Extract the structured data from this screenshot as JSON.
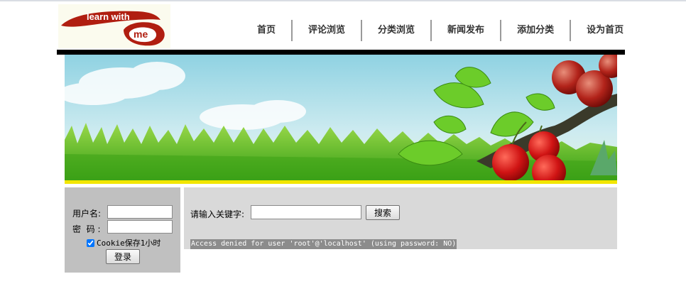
{
  "logo": {
    "text_learn_with": "learn with",
    "text_me": "me"
  },
  "nav": {
    "items": [
      "首页",
      "评论浏览",
      "分类浏览",
      "新闻发布",
      "添加分类",
      "设为首页"
    ]
  },
  "login": {
    "username_label": "用户名:",
    "password_label": "密  码 :",
    "username_value": "",
    "password_value": "",
    "cookie_label": "Cookie保存1小时",
    "cookie_checked": true,
    "submit_label": "登录"
  },
  "search": {
    "keyword_label": "请输入关键字:",
    "keyword_value": "",
    "button_label": "搜索",
    "error_message": "Access denied for user 'root'@'localhost' (using password: NO)"
  },
  "colors": {
    "banner_sky": "#9ed8e6",
    "grass": "#4caf1f",
    "yellow_strip": "#f2e600",
    "logo_red": "#b01e10"
  }
}
